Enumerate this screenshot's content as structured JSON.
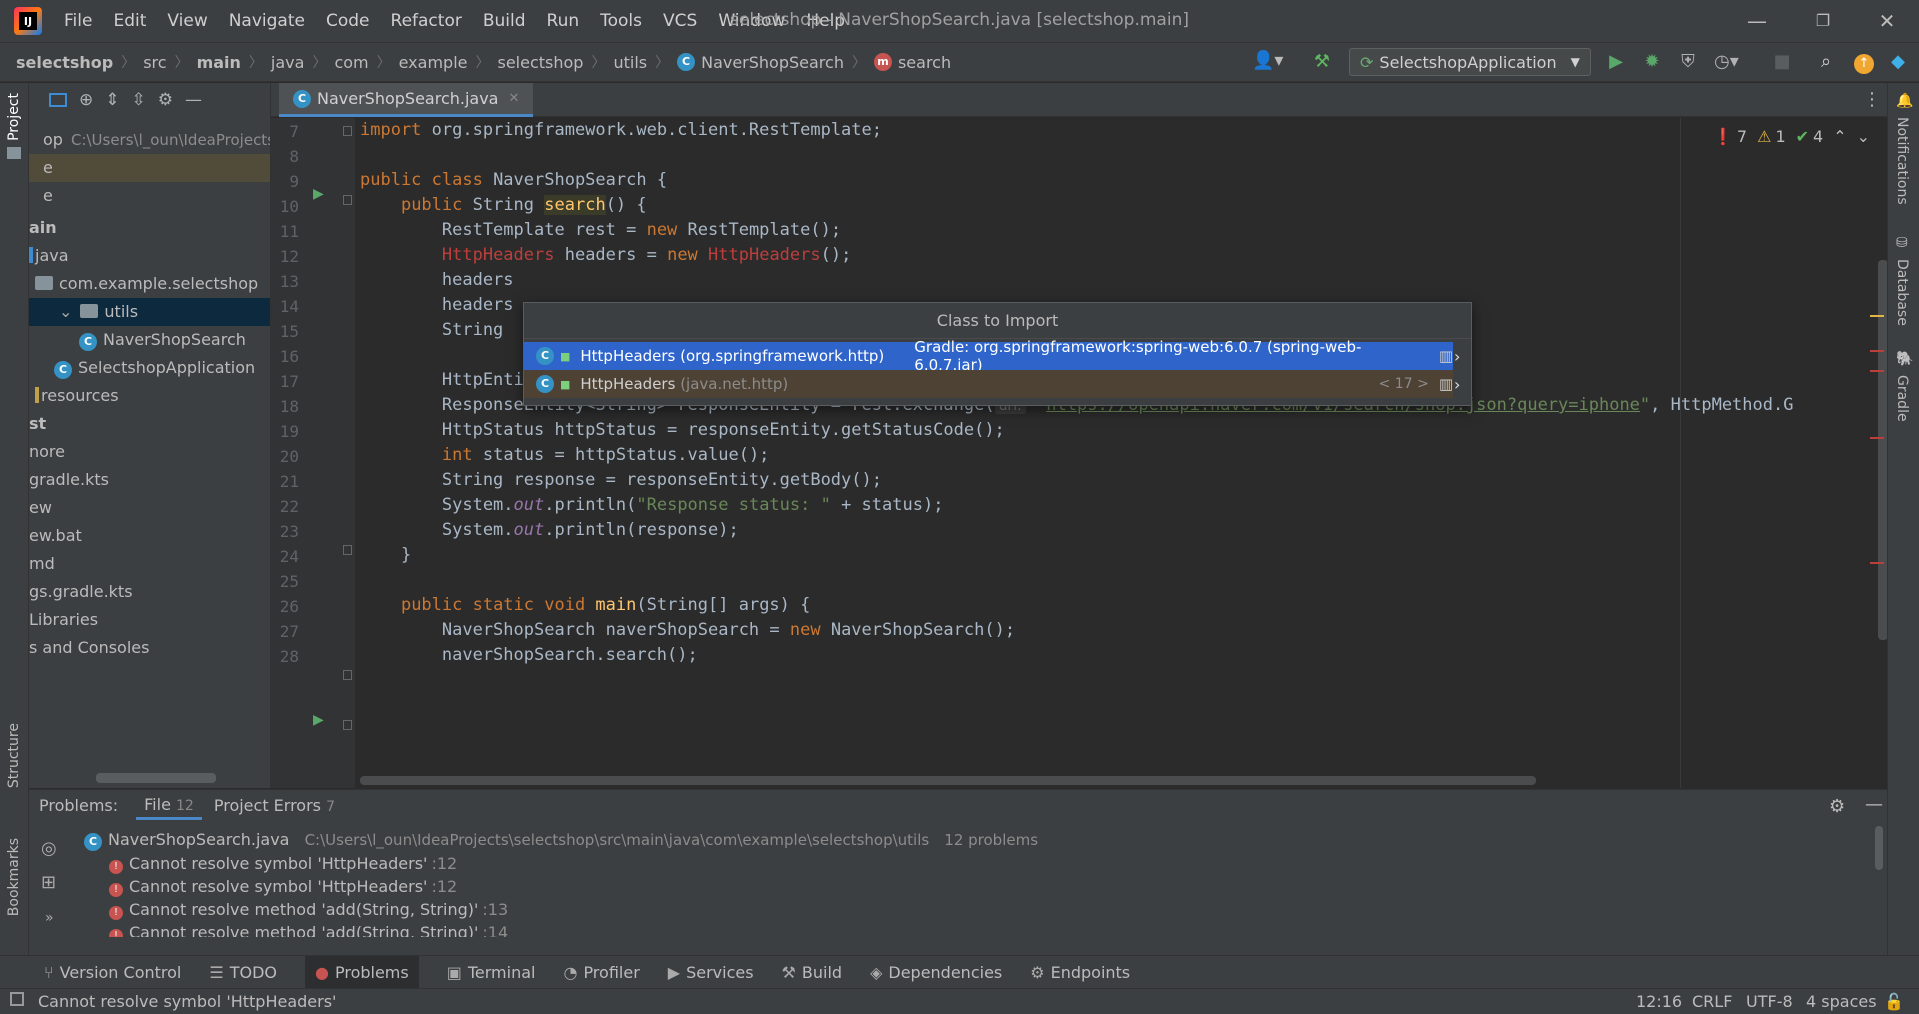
{
  "app": {
    "logo": "IJ",
    "menu": [
      "File",
      "Edit",
      "View",
      "Navigate",
      "Code",
      "Refactor",
      "Build",
      "Run",
      "Tools",
      "VCS",
      "Window",
      "Help"
    ],
    "window_title": "selectshop - NaverShopSearch.java [selectshop.main]"
  },
  "breadcrumb": [
    "selectshop",
    "src",
    "main",
    "java",
    "com",
    "example",
    "selectshop",
    "utils",
    "NaverShopSearch",
    "search"
  ],
  "run_config": "SelectshopApplication",
  "left_tabs": {
    "project": "Project",
    "structure": "Structure",
    "bookmarks": "Bookmarks"
  },
  "right_tabs": {
    "notifications": "Notifications",
    "database": "Database",
    "gradle": "Gradle"
  },
  "project_tree": [
    {
      "label": "op",
      "path": "C:\\Users\\l_oun\\IdeaProjects"
    },
    {
      "label": "e"
    },
    {
      "label": "e"
    },
    {
      "label": "ain"
    },
    {
      "label": "java"
    },
    {
      "label": "com.example.selectshop"
    },
    {
      "label": "utils"
    },
    {
      "label": "NaverShopSearch"
    },
    {
      "label": "SelectshopApplication"
    },
    {
      "label": "resources"
    },
    {
      "label": "st"
    },
    {
      "label": "nore"
    },
    {
      "label": "gradle.kts"
    },
    {
      "label": "ew"
    },
    {
      "label": "ew.bat"
    },
    {
      "label": "md"
    },
    {
      "label": "gs.gradle.kts"
    },
    {
      "label": "Libraries"
    },
    {
      "label": "s and Consoles"
    }
  ],
  "editor": {
    "tab": "NaverShopSearch.java",
    "inspection": {
      "errors": "7",
      "warnings": "1",
      "ok": "4"
    },
    "line_numbers": [
      "7",
      "8",
      "9",
      "10",
      "11",
      "12",
      "13",
      "14",
      "15",
      "16",
      "17",
      "18",
      "19",
      "20",
      "21",
      "22",
      "23",
      "24",
      "25",
      "26",
      "27",
      "28"
    ],
    "url_hint": "url:"
  },
  "import_popup": {
    "title": "Class to Import",
    "rows": [
      {
        "name": "HttpHeaders",
        "pkg": "(org.springframework.http)",
        "source": "Gradle: org.springframework:spring-web:6.0.7 (spring-web-6.0.7.jar)"
      },
      {
        "name": "HttpHeaders",
        "pkg": "(java.net.http)",
        "source": "< 17 >"
      }
    ]
  },
  "problems": {
    "title": "Problems:",
    "tabs": [
      {
        "label": "File",
        "count": "12"
      },
      {
        "label": "Project Errors",
        "count": "7"
      }
    ],
    "file": {
      "name": "NaverShopSearch.java",
      "path": "C:\\Users\\l_oun\\IdeaProjects\\selectshop\\src\\main\\java\\com\\example\\selectshop\\utils",
      "count": "12 problems"
    },
    "items": [
      {
        "text": "Cannot resolve symbol 'HttpHeaders'",
        "line": ":12"
      },
      {
        "text": "Cannot resolve symbol 'HttpHeaders'",
        "line": ":12"
      },
      {
        "text": "Cannot resolve method 'add(String, String)'",
        "line": ":13"
      },
      {
        "text": "Cannot resolve method 'add(String, String)'",
        "line": ":14"
      }
    ]
  },
  "bottom_tools": [
    "Version Control",
    "TODO",
    "Problems",
    "Terminal",
    "Profiler",
    "Services",
    "Build",
    "Dependencies",
    "Endpoints"
  ],
  "status": {
    "message": "Cannot resolve symbol 'HttpHeaders'",
    "position": "12:16",
    "line_sep": "CRLF",
    "encoding": "UTF-8",
    "indent": "4 spaces"
  },
  "colors": {
    "accent": "#4a88c7",
    "error": "#bc3f3c",
    "keyword": "#cc7832",
    "string": "#6a8759",
    "method": "#ffc66d"
  }
}
